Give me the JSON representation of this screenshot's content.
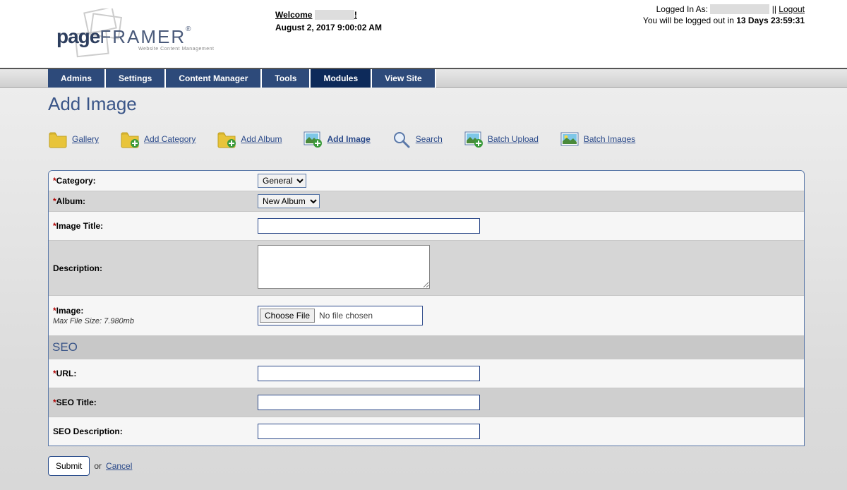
{
  "header": {
    "logo": {
      "part1": "page",
      "part2": "FRAMER",
      "reg": "®",
      "tagline": "Website Content Management"
    },
    "welcome_label": "Welcome",
    "welcome_exclaim": "!",
    "date": "August 2, 2017 9:00:02 AM",
    "logged_in_label": "Logged In As:",
    "sep": "||",
    "logout": "Logout",
    "logout_msg_prefix": "You will be logged out in ",
    "logout_time": "13 Days 23:59:31"
  },
  "nav": {
    "items": [
      "Admins",
      "Settings",
      "Content Manager",
      "Tools",
      "Modules",
      "View Site"
    ],
    "active_index": 4
  },
  "page": {
    "title": "Add Image"
  },
  "toolbar": {
    "items": [
      {
        "label": "Gallery",
        "icon": "folder",
        "bold": false
      },
      {
        "label": "Add Category",
        "icon": "folder-add",
        "bold": false
      },
      {
        "label": "Add Album",
        "icon": "folder-add",
        "bold": false
      },
      {
        "label": "Add Image",
        "icon": "image-add",
        "bold": true
      },
      {
        "label": "Search",
        "icon": "search",
        "bold": false
      },
      {
        "label": "Batch Upload",
        "icon": "image-add",
        "bold": false
      },
      {
        "label": "Batch Images",
        "icon": "image-landscape",
        "bold": false
      }
    ]
  },
  "form": {
    "category": {
      "label": "Category:",
      "value": "General"
    },
    "album": {
      "label": "Album:",
      "value": "New Album"
    },
    "image_title": {
      "label": "Image Title:",
      "value": ""
    },
    "description": {
      "label": "Description:",
      "value": ""
    },
    "image": {
      "label": "Image:",
      "hint": "Max File Size: 7.980mb",
      "choose": "Choose File",
      "no_file": "No file chosen"
    },
    "seo_header": "SEO",
    "url": {
      "label": "URL:",
      "value": ""
    },
    "seo_title": {
      "label": "SEO Title:",
      "value": ""
    },
    "seo_description": {
      "label": "SEO Description:",
      "value": ""
    }
  },
  "actions": {
    "submit": "Submit",
    "or": "or",
    "cancel": "Cancel"
  }
}
